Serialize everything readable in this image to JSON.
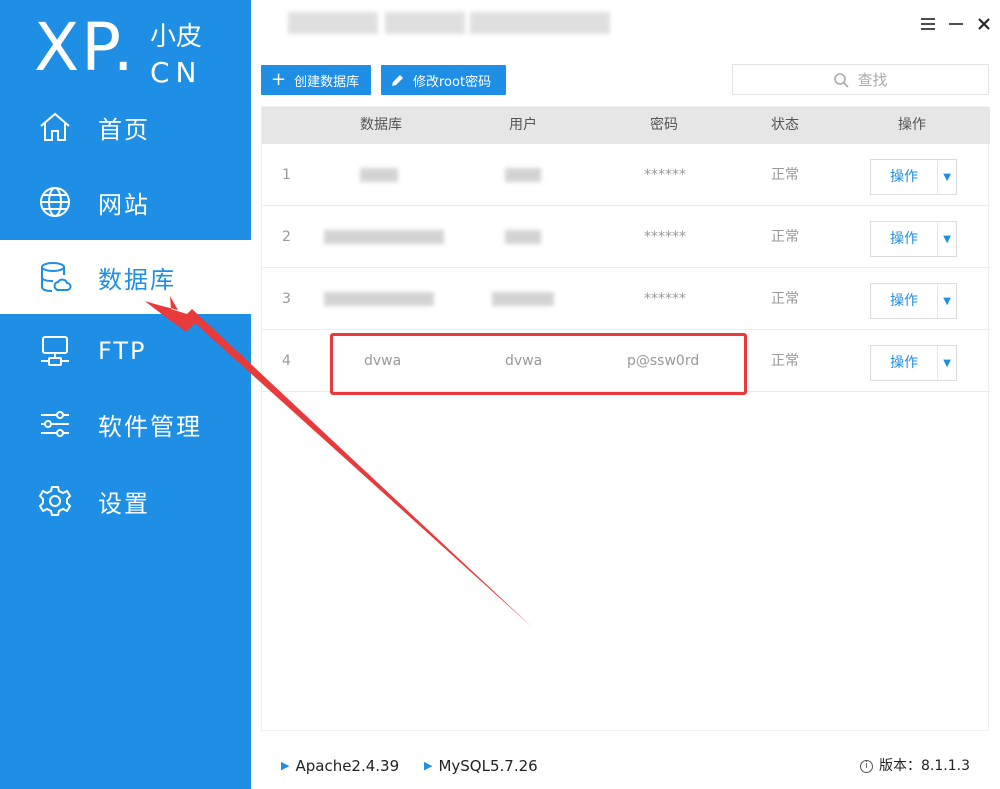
{
  "app": {
    "logo_main": "XP.",
    "logo_sub": "小皮",
    "logo_cn": "CN",
    "brand_color": "#1e8fe4"
  },
  "sidebar": {
    "items": [
      {
        "label": "首页",
        "icon": "home-icon",
        "active": false
      },
      {
        "label": "网站",
        "icon": "globe-icon",
        "active": false
      },
      {
        "label": "数据库",
        "icon": "database-icon",
        "active": true
      },
      {
        "label": "FTP",
        "icon": "server-icon",
        "active": false
      },
      {
        "label": "软件管理",
        "icon": "sliders-icon",
        "active": false
      },
      {
        "label": "设置",
        "icon": "gear-icon",
        "active": false
      }
    ]
  },
  "window": {
    "menu_icon": "menu-icon",
    "minimize_icon": "minimize-icon",
    "close_icon": "close-icon"
  },
  "toolbar": {
    "create_db_label": "创建数据库",
    "edit_root_label": "修改root密码",
    "search_placeholder": "查找"
  },
  "table": {
    "headers": [
      "数据库",
      "用户",
      "密码",
      "状态",
      "操作"
    ],
    "rows": [
      {
        "index": "1",
        "database": "",
        "user": "",
        "password": "******",
        "status": "正常",
        "action": "操作"
      },
      {
        "index": "2",
        "database": "",
        "user": "",
        "password": "******",
        "status": "正常",
        "action": "操作"
      },
      {
        "index": "3",
        "database": "",
        "user": "",
        "password": "******",
        "status": "正常",
        "action": "操作"
      },
      {
        "index": "4",
        "database": "dvwa",
        "user": "dvwa",
        "password": "p@ssw0rd",
        "status": "正常",
        "action": "操作"
      }
    ]
  },
  "statusbar": {
    "apache": "Apache2.4.39",
    "mysql": "MySQL5.7.26",
    "version_label": "版本：8.1.1.3"
  },
  "annotation_color": "#e83a3a"
}
